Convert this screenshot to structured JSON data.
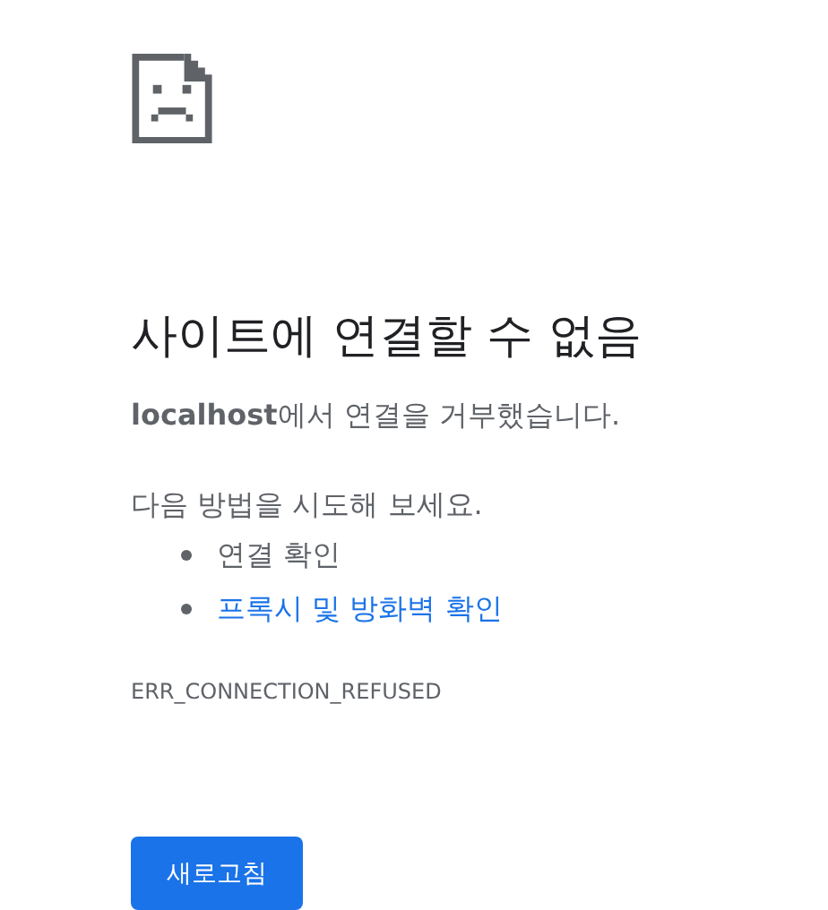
{
  "heading": "사이트에 연결할 수 없음",
  "message": "**localhost**에서 연결을 거부했습니다.",
  "suggestions_intro": "다음 방법을 시도해 보세요.",
  "suggestions": [
    {
      "kind": "text",
      "label": "연결 확인"
    },
    {
      "kind": "link",
      "label": "프록시 및 방화벽 확인"
    }
  ],
  "error_code": "ERR_CONNECTION_REFUSED",
  "buttons": [
    "새로고침"
  ]
}
